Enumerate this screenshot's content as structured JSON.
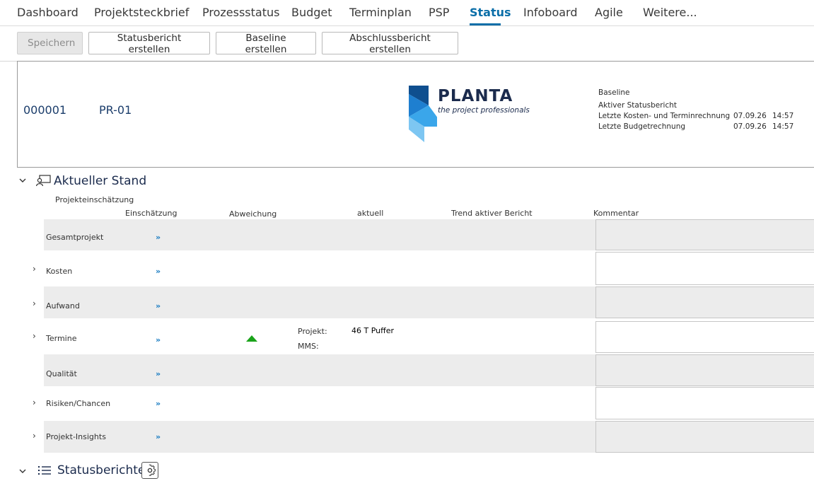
{
  "tabs": [
    {
      "label": "Dashboard"
    },
    {
      "label": "Projektsteckbrief"
    },
    {
      "label": "Prozessstatus"
    },
    {
      "label": "Budget"
    },
    {
      "label": "Terminplan"
    },
    {
      "label": "PSP"
    },
    {
      "label": "Status",
      "active": true
    },
    {
      "label": "Infoboard"
    },
    {
      "label": "Agile"
    },
    {
      "label": "Weitere..."
    }
  ],
  "toolbar": {
    "save": "Speichern",
    "status_report": "Statusbericht erstellen",
    "baseline": "Baseline erstellen",
    "final_report": "Abschlussbericht erstellen"
  },
  "header": {
    "project_number": "000001",
    "project_code": "PR-01",
    "logo_name": "PLANTA",
    "logo_tagline": "the project professionals",
    "baseline_label": "Baseline",
    "active_report_label": "Aktiver Statusbericht",
    "last_cost_label": "Letzte Kosten- und Terminrechnung",
    "last_cost_date": "07.09.26",
    "last_cost_time": "14:57",
    "last_budget_label": "Letzte Budgetrechnung",
    "last_budget_date": "07.09.26",
    "last_budget_time": "14:57"
  },
  "current": {
    "title": "Aktueller Stand",
    "subtitle": "Projekteinschätzung",
    "columns": [
      "Einschätzung",
      "Abweichung",
      "aktuell",
      "Trend aktiver Bericht",
      "Kommentar"
    ],
    "rows": [
      {
        "label": "Gesamtprojekt",
        "link": "»"
      },
      {
        "label": "Kosten",
        "link": "»"
      },
      {
        "label": "Aufwand",
        "link": "»"
      },
      {
        "label": "Termine",
        "link": "»",
        "project_label": "Projekt:",
        "project_value": "46 T Puffer",
        "mms_label": "MMS:"
      },
      {
        "label": "Qualität",
        "link": "»"
      },
      {
        "label": "Risiken/Chancen",
        "link": "»"
      },
      {
        "label": "Projekt-Insights",
        "link": "»"
      }
    ],
    "trend_color": "#1aa31a"
  },
  "reports": {
    "title": "Statusberichte"
  },
  "icons": {
    "collapse": "chevron-down-icon",
    "expand": "chevron-right-icon",
    "status": "monitor-user-icon",
    "list": "list-icon",
    "settings": "gear-icon"
  }
}
